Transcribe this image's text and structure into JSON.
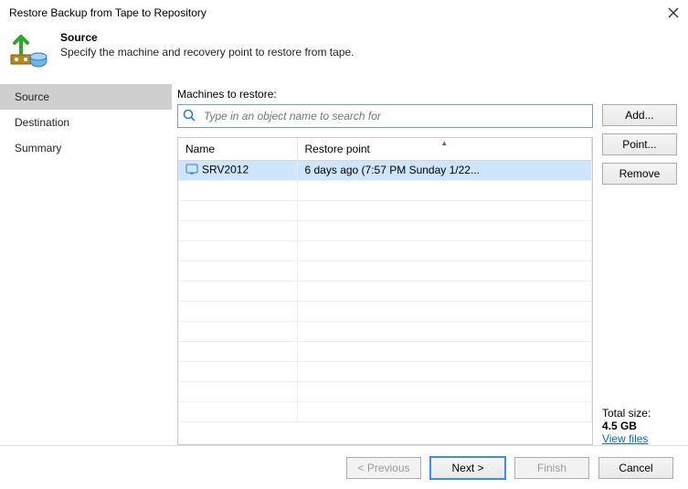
{
  "window": {
    "title": "Restore Backup from Tape to Repository"
  },
  "header": {
    "title": "Source",
    "subtitle": "Specify the machine and recovery point to restore from tape."
  },
  "nav": {
    "items": [
      {
        "label": "Source",
        "selected": true
      },
      {
        "label": "Destination",
        "selected": false
      },
      {
        "label": "Summary",
        "selected": false
      }
    ]
  },
  "main": {
    "label": "Machines to restore:",
    "search": {
      "placeholder": "Type in an object name to search for"
    },
    "columns": {
      "name": "Name",
      "restore_point": "Restore point"
    },
    "rows": [
      {
        "name": "SRV2012",
        "restore_point": "6 days ago (7:57 PM Sunday 1/22...",
        "selected": true
      }
    ],
    "blank_rows": 12,
    "buttons": {
      "add": "Add...",
      "point": "Point...",
      "remove": "Remove"
    },
    "totals": {
      "label": "Total size:",
      "value": "4.5 GB",
      "link": "View files"
    }
  },
  "footer": {
    "previous": "< Previous",
    "next": "Next >",
    "finish": "Finish",
    "cancel": "Cancel"
  }
}
